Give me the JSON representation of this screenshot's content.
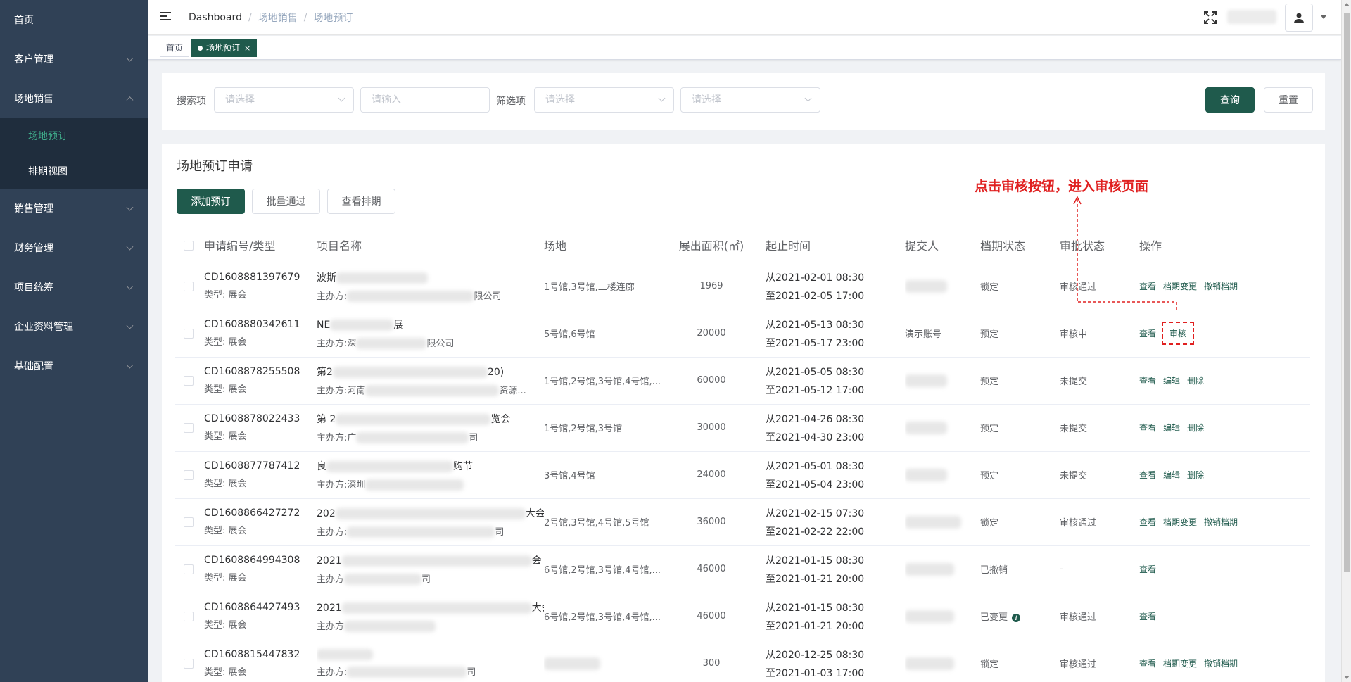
{
  "sidebar": {
    "items": [
      {
        "label": "首页",
        "has_children": false
      },
      {
        "label": "客户管理",
        "has_children": true
      },
      {
        "label": "场地销售",
        "has_children": true,
        "expanded": true
      },
      {
        "label": "销售管理",
        "has_children": true
      },
      {
        "label": "财务管理",
        "has_children": true
      },
      {
        "label": "项目统筹",
        "has_children": true
      },
      {
        "label": "企业资料管理",
        "has_children": true
      },
      {
        "label": "基础配置",
        "has_children": true
      }
    ],
    "submenu": [
      {
        "label": "场地预订",
        "active": true
      },
      {
        "label": "排期视图",
        "active": false
      }
    ]
  },
  "header": {
    "breadcrumb": [
      "Dashboard",
      "场地销售",
      "场地预订"
    ],
    "breadcrumb_separator": "/"
  },
  "tags": [
    {
      "label": "首页",
      "active": false
    },
    {
      "label": "场地预订",
      "active": true,
      "close": "×"
    }
  ],
  "search": {
    "search_item_label": "搜索项",
    "search_item_placeholder": "请选择",
    "search_input_placeholder": "请输入",
    "filter_label": "筛选项",
    "filter1_placeholder": "请选择",
    "filter2_placeholder": "请选择",
    "query_button": "查询",
    "reset_button": "重置"
  },
  "list": {
    "title": "场地预订申请",
    "add_button": "添加预订",
    "batch_button": "批量通过",
    "schedule_button": "查看排期",
    "annotation": "点击审核按钮，进入审核页面",
    "columns": [
      "申请编号/类型",
      "项目名称",
      "场地",
      "展出面积(㎡)",
      "起止时间",
      "提交人",
      "档期状态",
      "审批状态",
      "操作"
    ],
    "rows": [
      {
        "id": "CD1608881397679",
        "type": "类型: 展会",
        "name": "波斯",
        "org": "主办方:",
        "org_tail": "限公司",
        "venue": "1号馆,3号馆,二楼连廊",
        "area": "1969",
        "start": "从2021-02-01 08:30",
        "end": "至2021-02-05 17:00",
        "submitter": "",
        "schedule_status": "锁定",
        "approval_status": "审核通过",
        "ops": [
          "查看",
          "档期变更",
          "撤销档期"
        ]
      },
      {
        "id": "CD1608880342611",
        "type": "类型: 展会",
        "name": "NE",
        "name_tail": "展",
        "org": "主办方:深",
        "org_tail": "限公司",
        "venue": "5号馆,6号馆",
        "area": "20000",
        "start": "从2021-05-13 08:30",
        "end": "至2021-05-17 23:00",
        "submitter": "演示账号",
        "schedule_status": "预定",
        "approval_status": "审核中",
        "ops": [
          "查看",
          "审核"
        ]
      },
      {
        "id": "CD1608878255508",
        "type": "类型: 展会",
        "name": "第2",
        "name_tail": "20)",
        "org": "主办方:河南",
        "org_tail": "资源...",
        "venue": "1号馆,2号馆,3号馆,4号馆,...",
        "area": "60000",
        "start": "从2021-05-05 08:30",
        "end": "至2021-05-12 17:00",
        "submitter": "",
        "schedule_status": "预定",
        "approval_status": "未提交",
        "ops": [
          "查看",
          "编辑",
          "删除"
        ]
      },
      {
        "id": "CD1608878022433",
        "type": "类型: 展会",
        "name": "第 2",
        "name_tail": "览会",
        "org": "主办方:广",
        "org_tail": "司",
        "venue": "1号馆,2号馆,3号馆",
        "area": "30000",
        "start": "从2021-04-26 08:30",
        "end": "至2021-04-30 23:00",
        "submitter": "",
        "schedule_status": "预定",
        "approval_status": "未提交",
        "ops": [
          "查看",
          "编辑",
          "删除"
        ]
      },
      {
        "id": "CD1608877787412",
        "type": "类型: 展会",
        "name": "良",
        "name_tail": "购节",
        "org": "主办方:深圳",
        "org_tail": "",
        "venue": "3号馆,4号馆",
        "area": "24000",
        "start": "从2021-05-01 08:30",
        "end": "至2021-05-04 23:00",
        "submitter": "",
        "schedule_status": "预定",
        "approval_status": "未提交",
        "ops": [
          "查看",
          "编辑",
          "删除"
        ]
      },
      {
        "id": "CD1608866427272",
        "type": "类型: 展会",
        "name": "202",
        "name_tail": "大会",
        "org": "主办方:",
        "org_tail": "司",
        "venue": "2号馆,3号馆,4号馆,5号馆",
        "area": "36000",
        "start": "从2021-02-15 07:30",
        "end": "至2021-02-22 22:00",
        "submitter": "",
        "schedule_status": "锁定",
        "approval_status": "审核通过",
        "ops": [
          "查看",
          "档期变更",
          "撤销档期"
        ]
      },
      {
        "id": "CD1608864994308",
        "type": "类型: 展会",
        "name": "2021",
        "name_tail": "会",
        "org": "主办方",
        "org_tail": "司",
        "venue": "6号馆,2号馆,3号馆,4号馆,...",
        "area": "46000",
        "start": "从2021-01-15 08:30",
        "end": "至2021-01-21 20:00",
        "submitter": "",
        "schedule_status": "已撤销",
        "approval_status": "-",
        "ops": [
          "查看"
        ]
      },
      {
        "id": "CD1608864427493",
        "type": "类型: 展会",
        "name": "2021",
        "name_tail": "大会",
        "org": "主办方",
        "org_tail": "",
        "venue": "6号馆,2号馆,3号馆,4号馆,...",
        "area": "46000",
        "start": "从2021-01-15 08:30",
        "end": "至2021-01-21 20:00",
        "submitter": "",
        "schedule_status": "已变更",
        "approval_status": "审核通过",
        "ops": [
          "查看"
        ],
        "info": "i"
      },
      {
        "id": "CD1608815447832",
        "type": "类型: 展会",
        "name": "",
        "name_tail": "",
        "org": "主办方:",
        "org_tail": "司",
        "venue": "",
        "area": "300",
        "start": "从2020-12-25 08:30",
        "end": "至2021-01-03 17:00",
        "submitter": "",
        "schedule_status": "锁定",
        "approval_status": "审核通过",
        "ops": [
          "查看",
          "档期变更",
          "撤销档期"
        ]
      }
    ]
  },
  "colors": {
    "primary": "#1f5a4c",
    "sidebar": "#304156",
    "annotation": "#e02020"
  }
}
